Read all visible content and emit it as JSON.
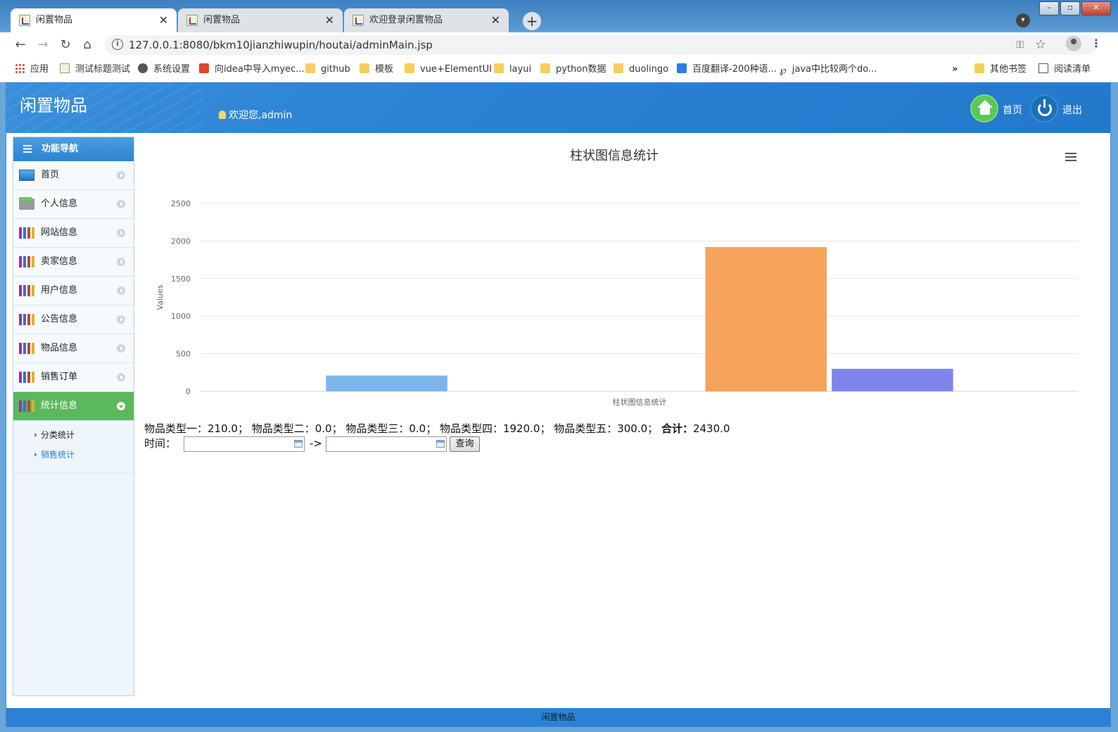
{
  "browser": {
    "tabs": [
      {
        "label": "闲置物品",
        "active": true
      },
      {
        "label": "闲置物品",
        "active": false
      },
      {
        "label": "欢迎登录闲置物品",
        "active": false
      }
    ],
    "url": "127.0.0.1:8080/bkm10jianzhiwupin/houtai/adminMain.jsp",
    "bookmarks": [
      {
        "label": "应用",
        "icon": "apps-grid-icon"
      },
      {
        "label": "测试标题测试",
        "icon": "page-icon"
      },
      {
        "label": "系统设置",
        "icon": "gear-icon"
      },
      {
        "label": "向idea中导入myec...",
        "icon": "csdn-icon"
      },
      {
        "label": "github",
        "icon": "folder-icon"
      },
      {
        "label": "模板",
        "icon": "folder-icon"
      },
      {
        "label": "vue+ElementUI",
        "icon": "folder-icon"
      },
      {
        "label": "layui",
        "icon": "folder-icon"
      },
      {
        "label": "python数据",
        "icon": "folder-icon"
      },
      {
        "label": "duolingo",
        "icon": "folder-icon"
      },
      {
        "label": "百度翻译-200种语...",
        "icon": "translate-icon"
      },
      {
        "label": "java中比较两个do...",
        "icon": "script-icon"
      }
    ],
    "overflow": "»",
    "other_bookmarks": "其他书签",
    "reading_list": "阅读清单"
  },
  "header": {
    "title": "闲置物品",
    "welcome": "欢迎您,admin",
    "home_label": "首页",
    "logout_label": "退出"
  },
  "sidebar": {
    "title": "功能导航",
    "items": [
      {
        "label": "首页",
        "icon": "monitor-icon"
      },
      {
        "label": "个人信息",
        "icon": "printer-icon"
      },
      {
        "label": "网站信息",
        "icon": "books-icon"
      },
      {
        "label": "卖家信息",
        "icon": "books-icon"
      },
      {
        "label": "用户信息",
        "icon": "books-icon"
      },
      {
        "label": "公告信息",
        "icon": "books-icon"
      },
      {
        "label": "物品信息",
        "icon": "books-icon"
      },
      {
        "label": "销售订单",
        "icon": "books-icon"
      },
      {
        "label": "统计信息",
        "icon": "books-icon",
        "active": true
      }
    ],
    "sub_items": [
      {
        "label": "分类统计",
        "current": false
      },
      {
        "label": "销售统计",
        "current": true
      }
    ]
  },
  "chart_data": {
    "type": "bar",
    "title": "柱状图信息统计",
    "xlabel": "柱状图信息统计",
    "ylabel": "Values",
    "ylim": [
      0,
      2500
    ],
    "yticks": [
      0,
      500,
      1000,
      1500,
      2000,
      2500
    ],
    "series": [
      {
        "name": "物品类型一",
        "value": 210.0,
        "color": "#7cb5ec"
      },
      {
        "name": "物品类型二",
        "value": 0.0,
        "color": "#434348"
      },
      {
        "name": "物品类型三",
        "value": 0.0,
        "color": "#90ed7d"
      },
      {
        "name": "物品类型四",
        "value": 1920.0,
        "color": "#f7a35c"
      },
      {
        "name": "物品类型五",
        "value": 300.0,
        "color": "#8085e9"
      }
    ],
    "legend": "bottom-center",
    "grid": true
  },
  "stats": {
    "line": "物品类型一：210.0； 物品类型二：0.0； 物品类型三：0.0； 物品类型四：1920.0； 物品类型五：300.0；",
    "total_label": "合计：",
    "total_value": "2430.0"
  },
  "query": {
    "time_label": "时间：",
    "arrow": "->",
    "start_value": "",
    "end_value": "",
    "button_label": "查询"
  },
  "footer": {
    "text": "闲置物品"
  }
}
